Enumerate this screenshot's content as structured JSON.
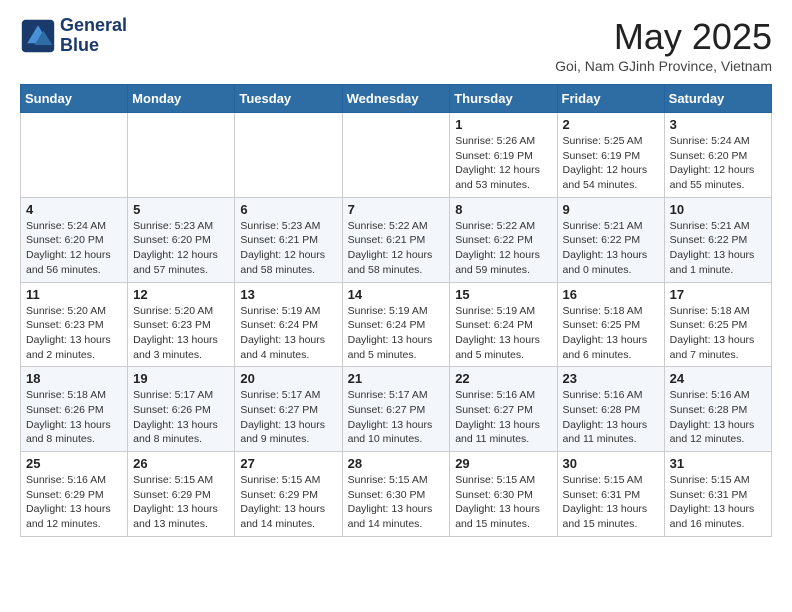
{
  "header": {
    "logo_line1": "General",
    "logo_line2": "Blue",
    "month_title": "May 2025",
    "subtitle": "Goi, Nam GJinh Province, Vietnam"
  },
  "days_of_week": [
    "Sunday",
    "Monday",
    "Tuesday",
    "Wednesday",
    "Thursday",
    "Friday",
    "Saturday"
  ],
  "weeks": [
    [
      {
        "day": "",
        "info": ""
      },
      {
        "day": "",
        "info": ""
      },
      {
        "day": "",
        "info": ""
      },
      {
        "day": "",
        "info": ""
      },
      {
        "day": "1",
        "info": "Sunrise: 5:26 AM\nSunset: 6:19 PM\nDaylight: 12 hours\nand 53 minutes."
      },
      {
        "day": "2",
        "info": "Sunrise: 5:25 AM\nSunset: 6:19 PM\nDaylight: 12 hours\nand 54 minutes."
      },
      {
        "day": "3",
        "info": "Sunrise: 5:24 AM\nSunset: 6:20 PM\nDaylight: 12 hours\nand 55 minutes."
      }
    ],
    [
      {
        "day": "4",
        "info": "Sunrise: 5:24 AM\nSunset: 6:20 PM\nDaylight: 12 hours\nand 56 minutes."
      },
      {
        "day": "5",
        "info": "Sunrise: 5:23 AM\nSunset: 6:20 PM\nDaylight: 12 hours\nand 57 minutes."
      },
      {
        "day": "6",
        "info": "Sunrise: 5:23 AM\nSunset: 6:21 PM\nDaylight: 12 hours\nand 58 minutes."
      },
      {
        "day": "7",
        "info": "Sunrise: 5:22 AM\nSunset: 6:21 PM\nDaylight: 12 hours\nand 58 minutes."
      },
      {
        "day": "8",
        "info": "Sunrise: 5:22 AM\nSunset: 6:22 PM\nDaylight: 12 hours\nand 59 minutes."
      },
      {
        "day": "9",
        "info": "Sunrise: 5:21 AM\nSunset: 6:22 PM\nDaylight: 13 hours\nand 0 minutes."
      },
      {
        "day": "10",
        "info": "Sunrise: 5:21 AM\nSunset: 6:22 PM\nDaylight: 13 hours\nand 1 minute."
      }
    ],
    [
      {
        "day": "11",
        "info": "Sunrise: 5:20 AM\nSunset: 6:23 PM\nDaylight: 13 hours\nand 2 minutes."
      },
      {
        "day": "12",
        "info": "Sunrise: 5:20 AM\nSunset: 6:23 PM\nDaylight: 13 hours\nand 3 minutes."
      },
      {
        "day": "13",
        "info": "Sunrise: 5:19 AM\nSunset: 6:24 PM\nDaylight: 13 hours\nand 4 minutes."
      },
      {
        "day": "14",
        "info": "Sunrise: 5:19 AM\nSunset: 6:24 PM\nDaylight: 13 hours\nand 5 minutes."
      },
      {
        "day": "15",
        "info": "Sunrise: 5:19 AM\nSunset: 6:24 PM\nDaylight: 13 hours\nand 5 minutes."
      },
      {
        "day": "16",
        "info": "Sunrise: 5:18 AM\nSunset: 6:25 PM\nDaylight: 13 hours\nand 6 minutes."
      },
      {
        "day": "17",
        "info": "Sunrise: 5:18 AM\nSunset: 6:25 PM\nDaylight: 13 hours\nand 7 minutes."
      }
    ],
    [
      {
        "day": "18",
        "info": "Sunrise: 5:18 AM\nSunset: 6:26 PM\nDaylight: 13 hours\nand 8 minutes."
      },
      {
        "day": "19",
        "info": "Sunrise: 5:17 AM\nSunset: 6:26 PM\nDaylight: 13 hours\nand 8 minutes."
      },
      {
        "day": "20",
        "info": "Sunrise: 5:17 AM\nSunset: 6:27 PM\nDaylight: 13 hours\nand 9 minutes."
      },
      {
        "day": "21",
        "info": "Sunrise: 5:17 AM\nSunset: 6:27 PM\nDaylight: 13 hours\nand 10 minutes."
      },
      {
        "day": "22",
        "info": "Sunrise: 5:16 AM\nSunset: 6:27 PM\nDaylight: 13 hours\nand 11 minutes."
      },
      {
        "day": "23",
        "info": "Sunrise: 5:16 AM\nSunset: 6:28 PM\nDaylight: 13 hours\nand 11 minutes."
      },
      {
        "day": "24",
        "info": "Sunrise: 5:16 AM\nSunset: 6:28 PM\nDaylight: 13 hours\nand 12 minutes."
      }
    ],
    [
      {
        "day": "25",
        "info": "Sunrise: 5:16 AM\nSunset: 6:29 PM\nDaylight: 13 hours\nand 12 minutes."
      },
      {
        "day": "26",
        "info": "Sunrise: 5:15 AM\nSunset: 6:29 PM\nDaylight: 13 hours\nand 13 minutes."
      },
      {
        "day": "27",
        "info": "Sunrise: 5:15 AM\nSunset: 6:29 PM\nDaylight: 13 hours\nand 14 minutes."
      },
      {
        "day": "28",
        "info": "Sunrise: 5:15 AM\nSunset: 6:30 PM\nDaylight: 13 hours\nand 14 minutes."
      },
      {
        "day": "29",
        "info": "Sunrise: 5:15 AM\nSunset: 6:30 PM\nDaylight: 13 hours\nand 15 minutes."
      },
      {
        "day": "30",
        "info": "Sunrise: 5:15 AM\nSunset: 6:31 PM\nDaylight: 13 hours\nand 15 minutes."
      },
      {
        "day": "31",
        "info": "Sunrise: 5:15 AM\nSunset: 6:31 PM\nDaylight: 13 hours\nand 16 minutes."
      }
    ]
  ]
}
